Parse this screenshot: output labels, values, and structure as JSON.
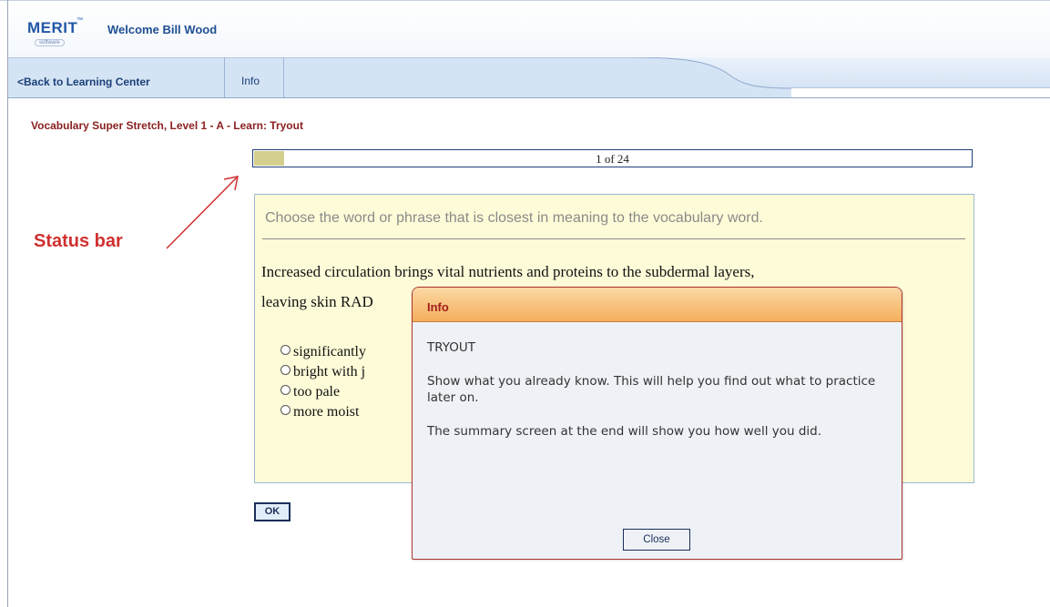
{
  "header": {
    "logo_text": "MERIT",
    "logo_sub": "software",
    "welcome": "Welcome Bill Wood"
  },
  "nav": {
    "back_label": "<Back to Learning Center",
    "info_label": "Info"
  },
  "lesson": {
    "title": "Vocabulary Super Stretch, Level 1 - A - Learn: Tryout"
  },
  "status": {
    "text": "1 of 24",
    "progress_fraction": 0.0417
  },
  "annotation": {
    "label": "Status bar"
  },
  "question": {
    "instruction": "Choose the word or phrase that is closest in meaning to the vocabulary word.",
    "line1": "Increased circulation brings vital nutrients and proteins to the subdermal layers,",
    "line2": "leaving skin RAD",
    "options": [
      {
        "label": "significantly"
      },
      {
        "label": "bright with j"
      },
      {
        "label": "too pale"
      },
      {
        "label": "more moist"
      }
    ],
    "ok_label": "OK"
  },
  "dialog": {
    "title": "Info",
    "heading": "TRYOUT",
    "para1": "Show what you already know. This will help you find out what to practice later on.",
    "para2": "The summary screen at the end will show you how well you did.",
    "close_label": "Close"
  },
  "colors": {
    "accent_blue": "#1f4f93",
    "title_red": "#8b2020",
    "annotation_red": "#d03030",
    "question_bg": "#fefcd8",
    "dialog_header": "#f4ae5c"
  }
}
